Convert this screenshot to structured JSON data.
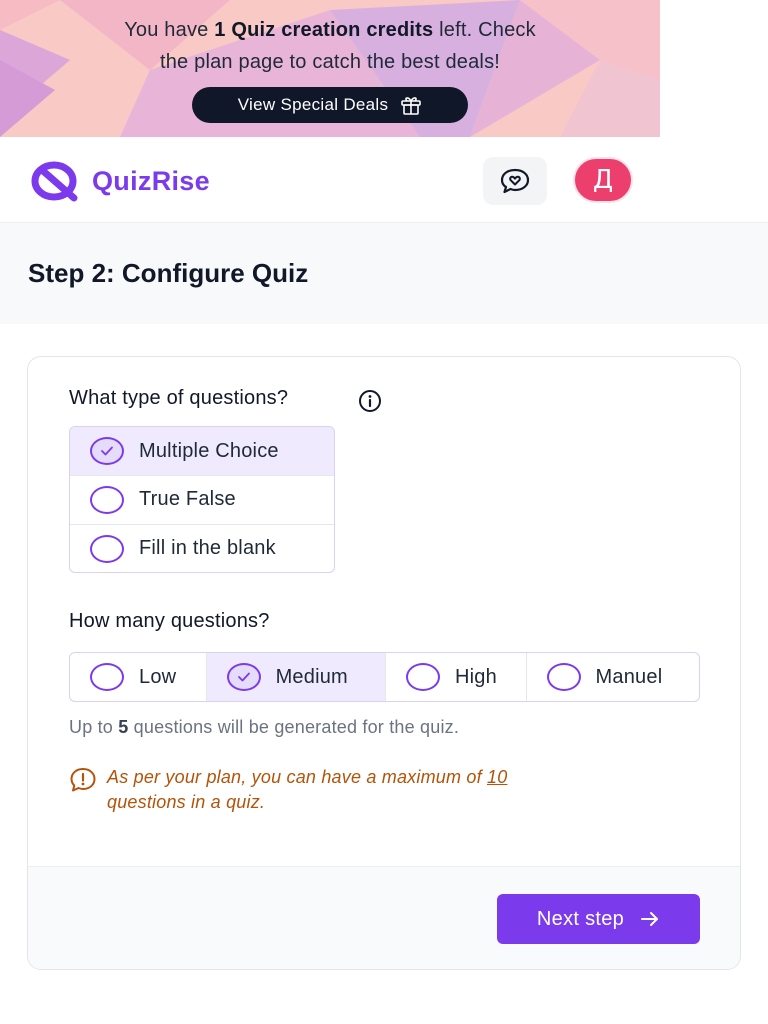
{
  "banner": {
    "text_prefix": "You have ",
    "credits_bold": "1 Quiz creation credits",
    "text_suffix": " left. Check",
    "text_line2": "the plan page to catch the best deals!",
    "button_label": "View Special Deals",
    "button_icon": "gift-icon"
  },
  "header": {
    "logo_text": "QuizRise",
    "chat_icon": "chat-heart-icon",
    "avatar_initial": "Д"
  },
  "step": {
    "title": "Step 2: Configure Quiz"
  },
  "question_type": {
    "label": "What type of questions?",
    "options": [
      {
        "label": "Multiple Choice",
        "selected": true
      },
      {
        "label": "True False",
        "selected": false
      },
      {
        "label": "Fill in the blank",
        "selected": false
      }
    ]
  },
  "question_count": {
    "label": "How many questions?",
    "options": [
      {
        "label": "Low",
        "selected": false
      },
      {
        "label": "Medium",
        "selected": true
      },
      {
        "label": "High",
        "selected": false
      },
      {
        "label": "Manuel",
        "selected": false
      }
    ],
    "hint_prefix": "Up to ",
    "hint_count": "5",
    "hint_suffix": " questions will be generated for the quiz."
  },
  "plan_note": {
    "prefix": "As per your plan, you can have a maximum of ",
    "limit": "10",
    "suffix": "questions in a quiz."
  },
  "footer": {
    "next_label": "Next step"
  },
  "colors": {
    "accent": "#7c3aed",
    "dark_button": "#0f1729",
    "avatar": "#ec3f6d",
    "warning_text": "#b45309"
  }
}
